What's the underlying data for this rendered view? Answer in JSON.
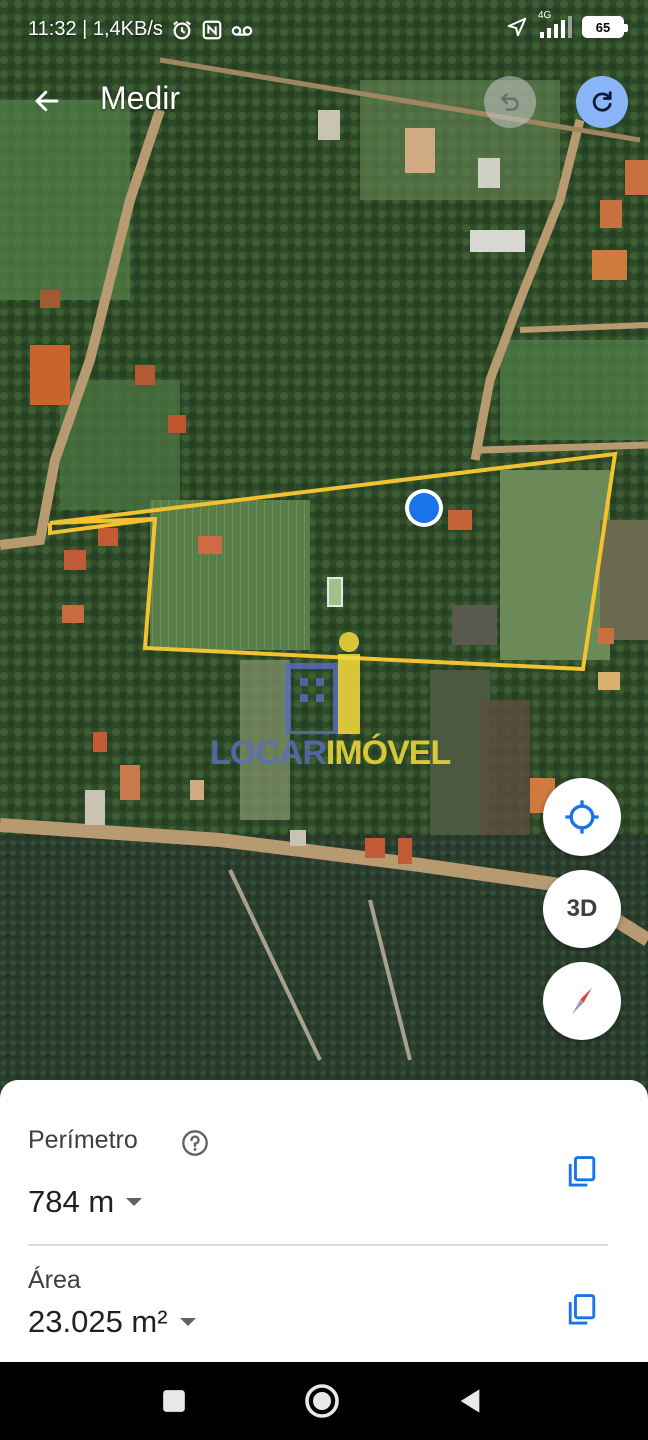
{
  "status_bar": {
    "time_speed": "11:32 | 1,4KB/s",
    "network": "4G",
    "battery": "65",
    "icons": [
      "alarm-icon",
      "nfc-icon",
      "voicemail-icon",
      "location-arrow-icon",
      "signal-icon",
      "battery-icon"
    ]
  },
  "header": {
    "title": "Medir",
    "back_icon": "arrow-left-icon",
    "undo_icon": "undo-icon",
    "redo_icon": "redo-icon"
  },
  "map": {
    "type": "satellite",
    "measure_line_color": "#f2c230",
    "location_dot_color": "#1a73e8",
    "watermark": {
      "part1": "LOCAR",
      "part2": "IMÓVEL",
      "color1": "#5a6ebe",
      "color2": "#f5dc3c"
    }
  },
  "map_controls": {
    "locate_icon": "crosshair-icon",
    "view_3d_label": "3D",
    "compass_icon": "compass-icon"
  },
  "measurement": {
    "perimeter_label": "Perímetro",
    "perimeter_value": "784 m",
    "area_label": "Área",
    "area_value": "23.025 m²",
    "help_icon": "help-icon",
    "copy_icon": "copy-icon"
  },
  "nav_bar": {
    "icons": [
      "recents-square-icon",
      "home-circle-icon",
      "back-triangle-icon"
    ]
  }
}
